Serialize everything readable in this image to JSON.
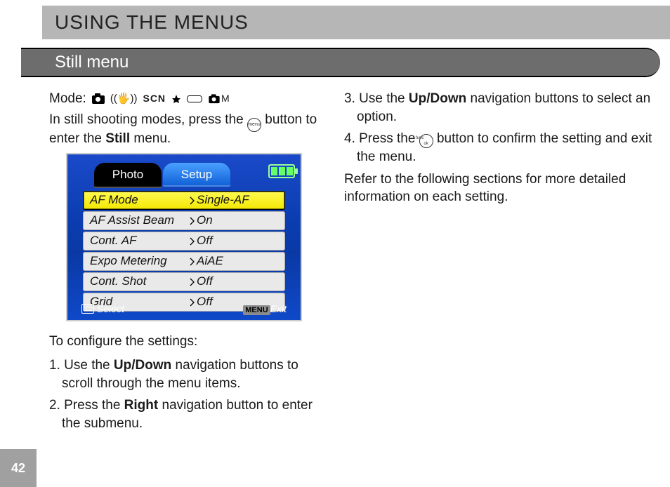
{
  "page_number": "42",
  "title": "USING THE MENUS",
  "section": "Still menu",
  "left": {
    "mode_label": "Mode:",
    "mode_icons": {
      "camera": "camera-icon",
      "hand": "anti-shake-icon",
      "scn": "SCN",
      "night": "night-icon",
      "pano": "panorama-icon",
      "manual_letter": "M"
    },
    "intro_1": "In still shooting modes, press the ",
    "intro_btn": "menu",
    "intro_2": " button to enter the ",
    "intro_bold": "Still",
    "intro_3": " menu.",
    "configure": "To configure the settings:",
    "step1a": "1. Use the ",
    "step1b": "Up/Down",
    "step1c": " navigation buttons to scroll through the menu items.",
    "step2a": "2. Press the ",
    "step2b": "Right",
    "step2c": " navigation button to enter the submenu."
  },
  "right": {
    "step3a": "3. Use the ",
    "step3b": "Up/Down",
    "step3c": " navigation buttons to select an option.",
    "step4a": "4. Press the ",
    "step4btn": "func ok",
    "step4b": " button to confirm the setting and exit the menu.",
    "refer": "Refer to the following sections for more de­tailed information on each setting."
  },
  "lcd": {
    "tabs": {
      "photo": "Photo",
      "setup": "Setup"
    },
    "rows": [
      {
        "label": "AF Mode",
        "value": "Single-AF",
        "selected": true
      },
      {
        "label": "AF Assist Beam",
        "value": "On",
        "selected": false
      },
      {
        "label": "Cont. AF",
        "value": "Off",
        "selected": false
      },
      {
        "label": "Expo Metering",
        "value": "AiAE",
        "selected": false
      },
      {
        "label": "Cont. Shot",
        "value": "Off",
        "selected": false
      },
      {
        "label": "Grid",
        "value": "Off",
        "selected": false
      }
    ],
    "footer": {
      "select": "Select",
      "menu": "MENU",
      "exit": "Exit"
    }
  }
}
